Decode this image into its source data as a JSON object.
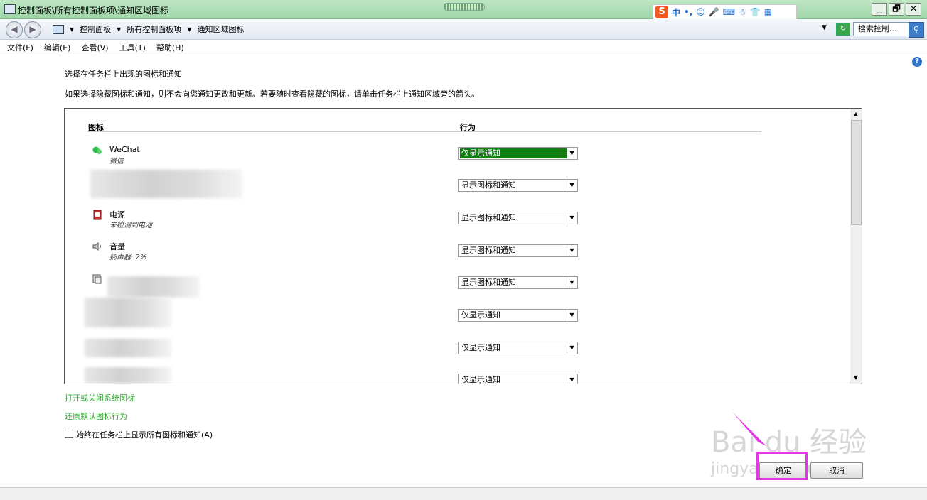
{
  "window": {
    "title": "控制面板\\所有控制面板项\\通知区域图标",
    "buttons": [
      "_",
      "🗗",
      "✕"
    ]
  },
  "ime_toolbar": {
    "logo": "S",
    "mode": "中",
    "punct": "•,"
  },
  "address": {
    "crumbs": [
      "控制面板",
      "所有控制面板项",
      "通知区域图标"
    ],
    "search_placeholder": "搜索控制..."
  },
  "menu": [
    "文件(F)",
    "编辑(E)",
    "查看(V)",
    "工具(T)",
    "帮助(H)"
  ],
  "content": {
    "heading": "选择在任务栏上出现的图标和通知",
    "description": "如果选择隐藏图标和通知，则不会向您通知更改和更新。若要随时查看隐藏的图标，请单击任务栏上通知区域旁的箭头。",
    "col_icon": "图标",
    "col_behavior": "行为",
    "rows": [
      {
        "name": "WeChat",
        "sub": "微信",
        "behavior": "仅显示通知",
        "selected": true
      },
      {
        "name": "",
        "sub": "",
        "behavior": "显示图标和通知"
      },
      {
        "name": "电源",
        "sub": "未检测到电池",
        "behavior": "显示图标和通知"
      },
      {
        "name": "音量",
        "sub": "扬声器: 2%",
        "behavior": "显示图标和通知"
      },
      {
        "name": "",
        "sub": "",
        "behavior": "显示图标和通知"
      },
      {
        "name": "",
        "sub": "",
        "behavior": "仅显示通知"
      },
      {
        "name": "",
        "sub": "",
        "behavior": "仅显示通知"
      },
      {
        "name": "",
        "sub": "",
        "behavior": "仅显示通知"
      }
    ],
    "link_system_icons": "打开或关闭系统图标",
    "link_restore": "还原默认图标行为",
    "always_show_label": "始终在任务栏上显示所有图标和通知(A)",
    "ok_label": "确定",
    "cancel_label": "取消"
  },
  "watermark": {
    "logo": "Bai du 经验",
    "url": "jingyan.baidu.com"
  },
  "colors": {
    "selection": "#127e12",
    "link": "#2fa82f",
    "highlight": "#e637e6"
  }
}
